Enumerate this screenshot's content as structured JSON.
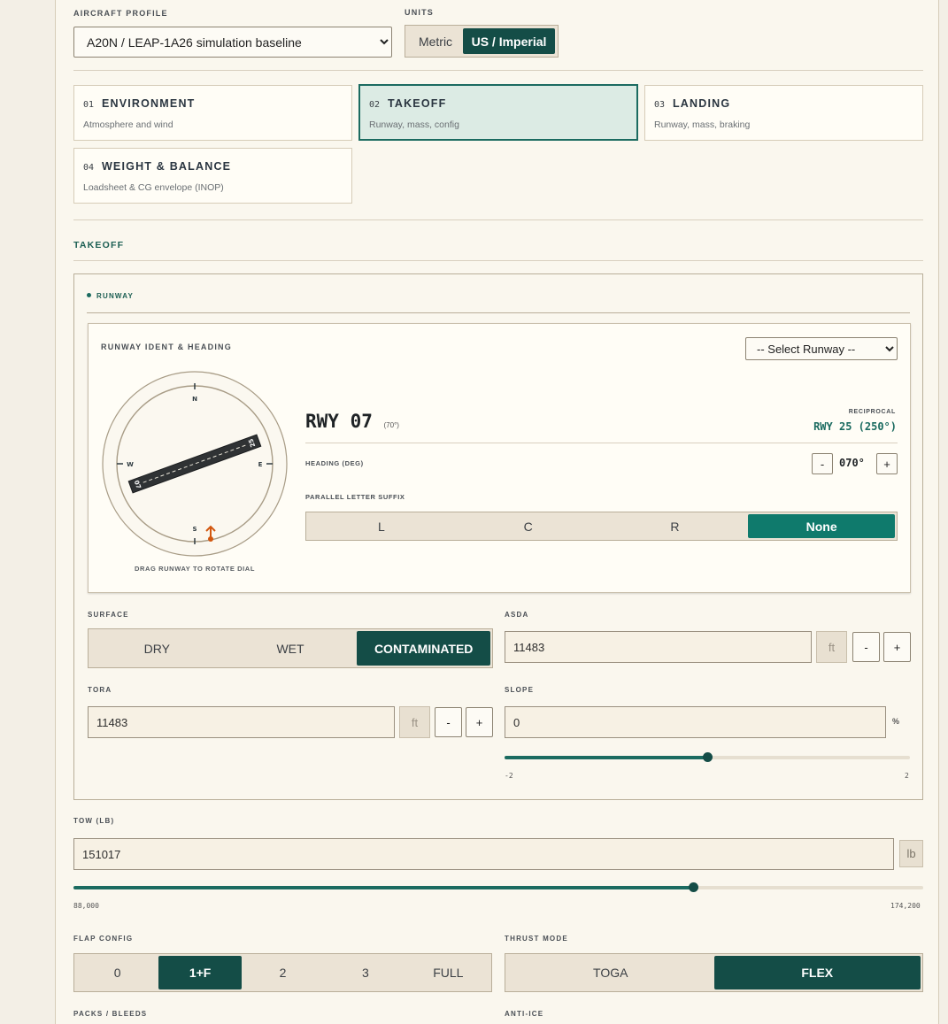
{
  "aircraft": {
    "label": "AIRCRAFT PROFILE",
    "selected": "A20N / LEAP-1A26 simulation baseline"
  },
  "units": {
    "label": "UNITS",
    "options": [
      "Metric",
      "US / Imperial"
    ],
    "selected": "US / Imperial"
  },
  "modules": [
    {
      "num": "01",
      "title": "ENVIRONMENT",
      "sub": "Atmosphere and wind"
    },
    {
      "num": "02",
      "title": "TAKEOFF",
      "sub": "Runway, mass, config",
      "active": true
    },
    {
      "num": "03",
      "title": "LANDING",
      "sub": "Runway, mass, braking"
    },
    {
      "num": "04",
      "title": "WEIGHT & BALANCE",
      "sub": "Loadsheet & CG envelope (INOP)"
    }
  ],
  "section_title": "TAKEOFF",
  "runway_group": {
    "label": "RUNWAY",
    "ident_label": "RUNWAY IDENT & HEADING",
    "select_placeholder": "-- Select Runway --",
    "dial": {
      "north": "N",
      "south": "S",
      "east": "E",
      "west": "W",
      "hint": "DRAG RUNWAY TO ROTATE DIAL",
      "heading_deg": 70,
      "end_a": "07",
      "end_b": "25"
    },
    "rwy_title": "RWY 07",
    "rwy_heading_small": "(70°)",
    "reciprocal_label": "RECIPROCAL",
    "reciprocal_value": "RWY 25 (250°)",
    "heading_label": "HEADING (DEG)",
    "heading_value": "070°",
    "minus": "-",
    "plus": "+",
    "suffix_label": "PARALLEL LETTER SUFFIX",
    "suffix_options": [
      "L",
      "C",
      "R",
      "None"
    ],
    "suffix_selected": "None",
    "surface_label": "SURFACE",
    "surface_options": [
      "DRY",
      "WET",
      "CONTAMINATED"
    ],
    "surface_selected": "CONTAMINATED",
    "asda_label": "ASDA",
    "asda_value": "11483",
    "asda_unit": "ft",
    "tora_label": "TORA",
    "tora_value": "11483",
    "tora_unit": "ft",
    "slope_label": "SLOPE",
    "slope_value": "0",
    "slope_unit": "%",
    "slope_min": "-2",
    "slope_max": "2",
    "slope_fraction": 0.5
  },
  "tow": {
    "label": "TOW (LB)",
    "value": "151017",
    "unit": "lb",
    "min": "88,000",
    "max": "174,200",
    "fraction": 0.729
  },
  "flap": {
    "label": "FLAP CONFIG",
    "options": [
      "0",
      "1+F",
      "2",
      "3",
      "FULL"
    ],
    "selected": "1+F"
  },
  "thrust": {
    "label": "THRUST MODE",
    "options": [
      "TOGA",
      "FLEX"
    ],
    "selected": "FLEX"
  },
  "packs_label": "PACKS / BLEEDS",
  "anti_ice_label": "ANTI-ICE",
  "colors": {
    "accent_dark": "#144d47",
    "accent_teal": "#0f7a6c",
    "dial_marker": "#d2570f"
  }
}
